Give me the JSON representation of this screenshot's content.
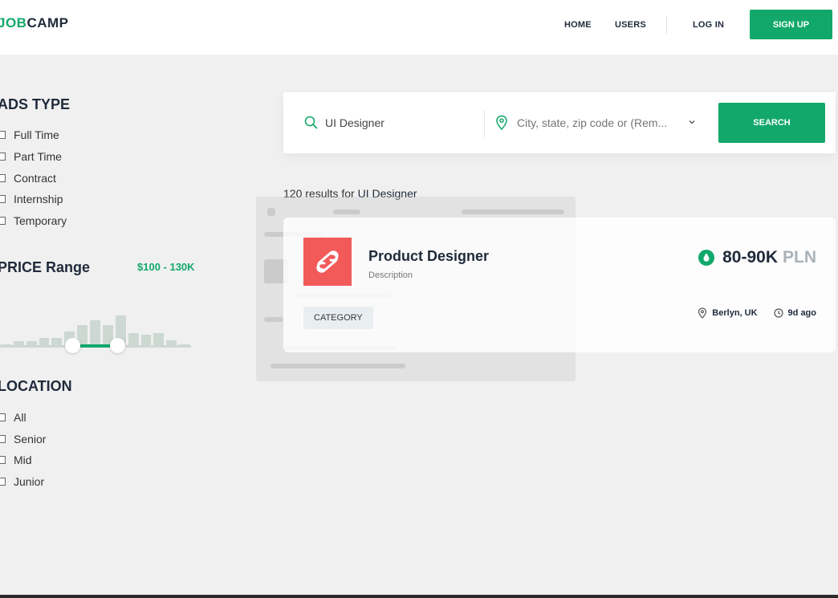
{
  "header": {
    "logo_part1": "JOB",
    "logo_part2": "CAMP",
    "nav": {
      "home": "HOME",
      "users": "USERS",
      "login": "LOG IN",
      "signup": "SIGN UP"
    }
  },
  "sidebar": {
    "ads_type": {
      "title": "ADS TYPE",
      "options": [
        "Full Time",
        "Part Time",
        "Contract",
        "Internship",
        "Temporary"
      ]
    },
    "price": {
      "title": "PRICE Range",
      "range_text": "$100 - 130K",
      "histogram": [
        4,
        8,
        8,
        12,
        12,
        20,
        28,
        34,
        28,
        40,
        18,
        16,
        18,
        9,
        4
      ],
      "range_fraction": [
        0.375,
        0.6
      ]
    },
    "location": {
      "title": "LOCATION",
      "options": [
        "All",
        "Senior",
        "Mid",
        "Junior"
      ]
    }
  },
  "search": {
    "query": "UI Designer",
    "location_placeholder": "City, state, zip code or (Rem...",
    "button": "SEARCH",
    "icons": {
      "query": "search-icon",
      "location": "map-pin-icon",
      "dropdown": "chevron-down-icon"
    }
  },
  "results": {
    "count_text": "120 results for",
    "query": "UI Designer"
  },
  "job": {
    "title": "Product Designer",
    "description": "Description",
    "category": "CATEGORY",
    "salary": "80-90K",
    "currency": "PLN",
    "location": "Berlyn, UK",
    "posted": "9d ago",
    "icons": {
      "logo": "infinity-icon",
      "salary": "drop-icon",
      "location": "map-pin-icon",
      "time": "clock-icon"
    }
  },
  "colors": {
    "accent": "#13a86b",
    "logo_bg": "#f25a5a",
    "dark": "#1f2a3a",
    "page_bg": "#f0f0f0"
  }
}
